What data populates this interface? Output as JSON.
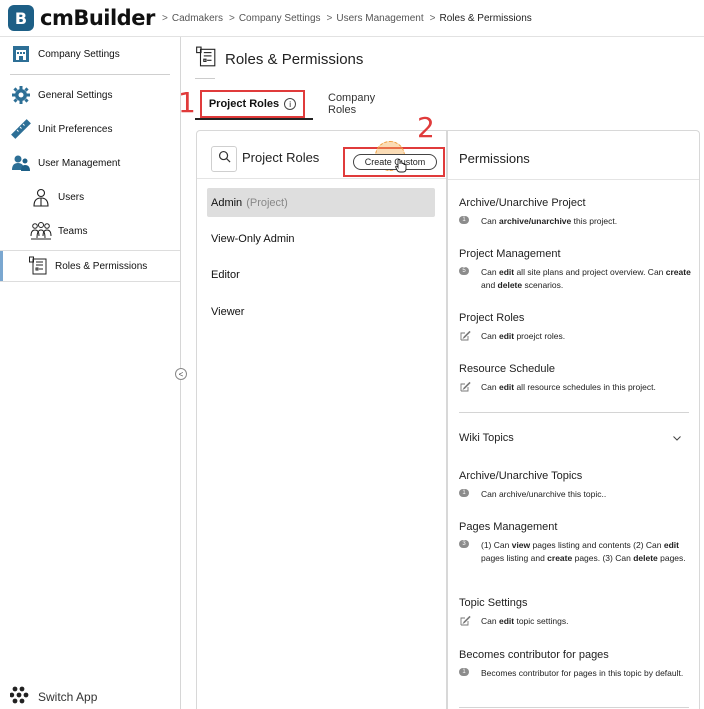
{
  "app": {
    "logo_letter": "B",
    "logo_text": "cmBuilder"
  },
  "breadcrumb": [
    "Cadmakers",
    "Company Settings",
    "Users Management",
    "Roles & Permissions"
  ],
  "sidebar": {
    "items": [
      {
        "label": "Company Settings",
        "icon": "building-icon"
      },
      {
        "label": "General Settings",
        "icon": "gear-icon"
      },
      {
        "label": "Unit Preferences",
        "icon": "ruler-icon"
      },
      {
        "label": "User Management",
        "icon": "users-icon"
      },
      {
        "label": "Users",
        "icon": "user-icon"
      },
      {
        "label": "Teams",
        "icon": "team-icon"
      },
      {
        "label": "Roles & Permissions",
        "icon": "roles-icon"
      }
    ],
    "switch_app": "Switch App"
  },
  "page": {
    "title": "Roles & Permissions"
  },
  "tabs": [
    {
      "label": "Project Roles",
      "active": true,
      "info": "i"
    },
    {
      "label": "Company Roles",
      "active": false
    }
  ],
  "annotations": {
    "one": "1",
    "two": "2"
  },
  "roles_panel": {
    "title": "Project Roles",
    "create_button": "Create Custom",
    "roles": [
      {
        "label": "Admin",
        "suffix": "(Project)"
      },
      {
        "label": "View-Only Admin"
      },
      {
        "label": "Editor"
      },
      {
        "label": "Viewer"
      }
    ]
  },
  "permissions_panel": {
    "title": "Permissions",
    "project_perms": [
      {
        "title": "Archive/Unarchive Project",
        "badge": "1",
        "desc_html": "Can <b>archive/unarchive</b> this project."
      },
      {
        "title": "Project Management",
        "badge": "5",
        "desc_html": "Can <b>edit</b> all site plans and project overview. Can <b>create</b> and <b>delete</b> scenarios."
      },
      {
        "title": "Project Roles",
        "badge": "",
        "desc_html": "Can <b>edit</b> proejct roles."
      },
      {
        "title": "Resource Schedule",
        "badge": "",
        "desc_html": "Can <b>edit</b> all resource schedules in this project."
      }
    ],
    "wiki_section": "Wiki Topics",
    "wiki_perms": [
      {
        "title": "Archive/Unarchive Topics",
        "badge": "1",
        "desc_html": "Can archive/unarchive this topic.."
      },
      {
        "title": "Pages Management",
        "badge": "3",
        "desc_html": "(1) Can <b>view</b> pages listing and contents (2) Can <b>edit</b> pages listing and <b>create</b> pages. (3) Can <b>delete</b> pages."
      },
      {
        "title": "Topic Settings",
        "badge": "",
        "desc_html": "Can <b>edit</b> topic settings."
      },
      {
        "title": "Becomes contributor for pages",
        "badge": "1",
        "desc_html": "Becomes contributor for pages in this topic by default."
      }
    ]
  },
  "colors": {
    "brand": "#1d5f86",
    "annotation": "#e03b3b",
    "selected_row": "#dedede"
  }
}
